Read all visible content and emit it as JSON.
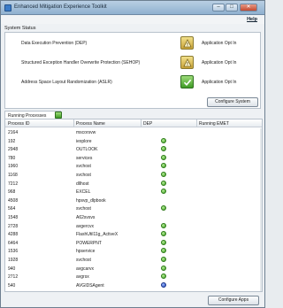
{
  "window": {
    "title": "Enhanced Mitigation Experience Toolkit",
    "controls": {
      "minimize": "–",
      "maximize": "□",
      "close": "✕"
    }
  },
  "menu": {
    "help": "Help"
  },
  "system_status": {
    "heading": "System Status",
    "rows": [
      {
        "label": "Data Execution Prevention (DEP)",
        "state": "warn",
        "value": "Application Opt In",
        "icon": "warning-icon"
      },
      {
        "label": "Structured Exception Handler Overwrite Protection (SEHOP)",
        "state": "warn",
        "value": "Application Opt In",
        "icon": "warning-icon"
      },
      {
        "label": "Address Space Layout Randomization (ASLR)",
        "state": "ok",
        "value": "Application Opt In",
        "icon": "check-icon"
      }
    ],
    "configure_button": "Configure System"
  },
  "running_processes": {
    "tab_label": "Running Processes",
    "columns": [
      "Process ID",
      "Process Name",
      "DEP",
      "Running EMET"
    ],
    "rows": [
      {
        "pid": "2164",
        "name": "mscorsvw",
        "dep": ""
      },
      {
        "pid": "192",
        "name": "iexplore",
        "dep": "on"
      },
      {
        "pid": "2948",
        "name": "OUTLOOK",
        "dep": "on"
      },
      {
        "pid": "780",
        "name": "services",
        "dep": "on"
      },
      {
        "pid": "1960",
        "name": "svchost",
        "dep": "on"
      },
      {
        "pid": "1168",
        "name": "svchost",
        "dep": "on"
      },
      {
        "pid": "7212",
        "name": "dllhost",
        "dep": "on"
      },
      {
        "pid": "968",
        "name": "EXCEL",
        "dep": "on"
      },
      {
        "pid": "4508",
        "name": "hpsvp_dlpbook",
        "dep": ""
      },
      {
        "pid": "564",
        "name": "svchost",
        "dep": "on"
      },
      {
        "pid": "1548",
        "name": "A62svsvs",
        "dep": ""
      },
      {
        "pid": "2728",
        "name": "avgercvx",
        "dep": "on"
      },
      {
        "pid": "4288",
        "name": "FlashUtil11g_ActiveX",
        "dep": "on"
      },
      {
        "pid": "6464",
        "name": "POWERPNT",
        "dep": "on"
      },
      {
        "pid": "1536",
        "name": "hpservice",
        "dep": "on"
      },
      {
        "pid": "1928",
        "name": "svchost",
        "dep": "on"
      },
      {
        "pid": "940",
        "name": "avgcarvx",
        "dep": "on"
      },
      {
        "pid": "2712",
        "name": "avgrsx",
        "dep": "on"
      },
      {
        "pid": "540",
        "name": "AVGIDSAgent",
        "dep": "info"
      }
    ],
    "configure_button": "Configure Apps"
  },
  "colors": {
    "title_bar": "#a8c2da",
    "dep_enabled": "#3a9a1e",
    "dep_info": "#2346b8",
    "warning_badge": "#c9a43a",
    "ok_badge": "#3e9a25"
  }
}
